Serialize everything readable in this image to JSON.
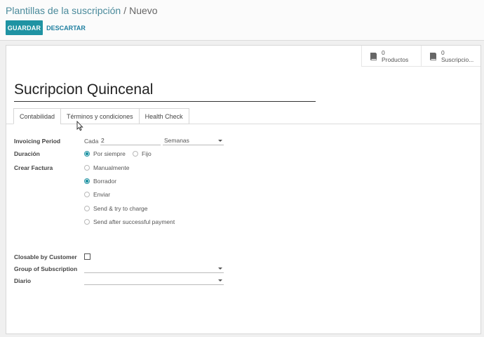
{
  "breadcrumb": {
    "parent": "Plantillas de la suscripción",
    "separator": "/",
    "current": "Nuevo"
  },
  "toolbar": {
    "save_label": "GUARDAR",
    "discard_label": "DESCARTAR"
  },
  "stat_buttons": [
    {
      "value": "0",
      "label": "Productos",
      "icon": "book-icon"
    },
    {
      "value": "0",
      "label": "Suscripcio...",
      "icon": "book-icon"
    }
  ],
  "record": {
    "name": "Sucripcion Quincenal"
  },
  "tabs": [
    {
      "label": "Contabilidad",
      "active": true
    },
    {
      "label": "Términos y condiciones",
      "active": false
    },
    {
      "label": "Health Check",
      "active": false
    }
  ],
  "fields": {
    "invoicing_period": {
      "label": "Invoicing Period",
      "prefix": "Cada",
      "value": "2",
      "unit": "Semanas"
    },
    "duracion": {
      "label": "Duración",
      "options": [
        {
          "label": "Por siempre",
          "checked": true
        },
        {
          "label": "Fijo",
          "checked": false
        }
      ]
    },
    "crear_factura": {
      "label": "Crear Factura",
      "options": [
        {
          "label": "Manualmente",
          "checked": false
        },
        {
          "label": "Borrador",
          "checked": true
        },
        {
          "label": "Enviar",
          "checked": false
        },
        {
          "label": "Send & try to charge",
          "checked": false
        },
        {
          "label": "Send after successful payment",
          "checked": false
        }
      ]
    },
    "closable": {
      "label": "Closable by Customer",
      "checked": false
    },
    "group": {
      "label": "Group of Subscription",
      "value": ""
    },
    "diario": {
      "label": "Diario",
      "value": ""
    }
  },
  "colors": {
    "accent": "#1f93a3",
    "breadcrumb_link": "#4a8a9b"
  }
}
